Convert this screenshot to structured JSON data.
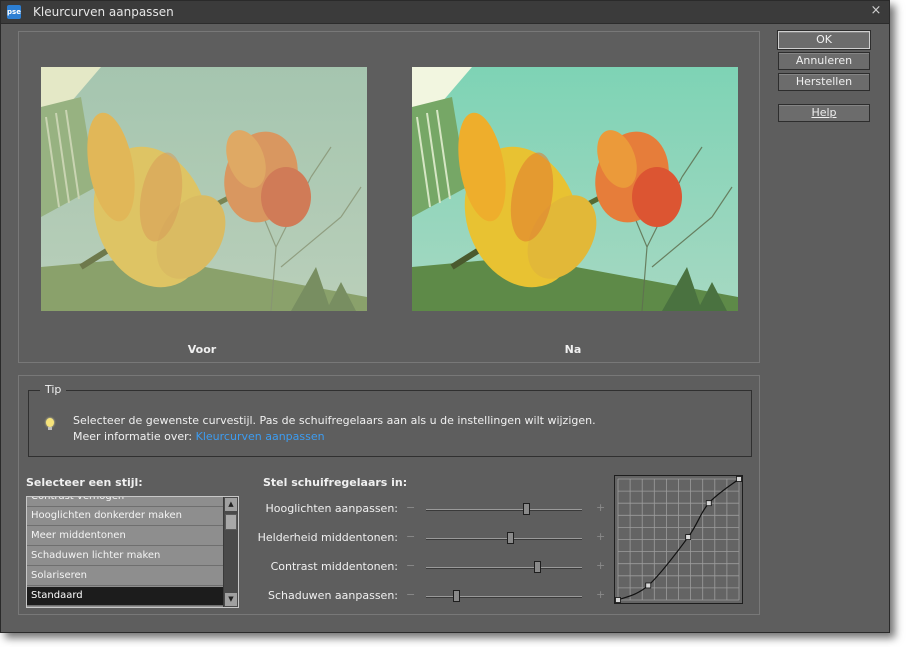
{
  "window": {
    "title": "Kleurcurven aanpassen",
    "app_icon_text": "pse",
    "close_glyph": "×"
  },
  "preview": {
    "before_label": "Voor",
    "after_label": "Na"
  },
  "buttons": {
    "ok": "OK",
    "cancel": "Annuleren",
    "reset": "Herstellen",
    "help": "Help"
  },
  "tip": {
    "title": "Tip",
    "line1": "Selecteer de gewenste curvestijl. Pas de schuifregelaars aan als u de instellingen wilt wijzigen.",
    "line2_prefix": "Meer informatie over: ",
    "link": "Kleurcurven aanpassen",
    "icon": "lightbulb-icon"
  },
  "style_list": {
    "heading": "Selecteer een stijl:",
    "items": [
      "Contrast verhogen",
      "Hooglichten donkerder maken",
      "Meer middentonen",
      "Schaduwen lichter maken",
      "Solariseren",
      "Standaard"
    ],
    "selected": "Standaard"
  },
  "sliders": {
    "heading": "Stel schuifregelaars in:",
    "minus": "−",
    "plus": "+",
    "items": [
      {
        "label": "Hooglichten aanpassen:",
        "value": 0.64
      },
      {
        "label": "Helderheid middentonen:",
        "value": 0.54
      },
      {
        "label": "Contrast middentonen:",
        "value": 0.71
      },
      {
        "label": "Schaduwen aanpassen:",
        "value": 0.19
      }
    ]
  },
  "curve": {
    "grid_divisions": 10,
    "control_points": [
      [
        0,
        0
      ],
      [
        0.25,
        0.12
      ],
      [
        0.58,
        0.52
      ],
      [
        0.75,
        0.8
      ],
      [
        1,
        1
      ]
    ]
  },
  "colors": {
    "window_bg": "#5e5e5e",
    "titlebar_bg": "#3b3b3b",
    "link": "#3d9cf0",
    "list_item_bg": "#8e8e8e",
    "list_selected_bg": "#1c1c1c"
  }
}
